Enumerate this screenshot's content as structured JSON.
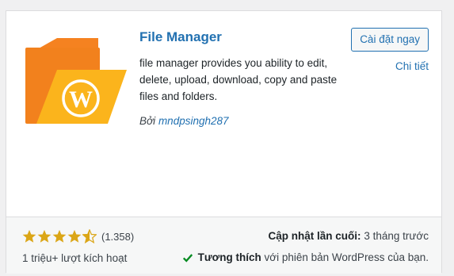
{
  "plugin": {
    "title": "File Manager",
    "description": "file manager provides you ability to edit, delete, upload, download, copy and paste files and folders.",
    "author_prefix": "Bởi",
    "author_name": "mndpsingh287",
    "icon": "wordpress-logo-folder",
    "install_label": "Cài đặt ngay",
    "details_label": "Chi tiết"
  },
  "footer": {
    "rating_value": 4.5,
    "rating_count": "(1.358)",
    "active_installs": "1 triệu+ lượt kích hoạt",
    "last_updated_label": "Cập nhật lần cuối:",
    "last_updated_value": "3 tháng trước",
    "compat_strong": "Tương thích",
    "compat_rest": "với phiên bản WordPress của bạn."
  },
  "colors": {
    "link": "#2271b1",
    "star": "#dba617",
    "check": "#008a20",
    "folder_orange": "#f58220",
    "folder_yellow": "#fbb41c"
  }
}
